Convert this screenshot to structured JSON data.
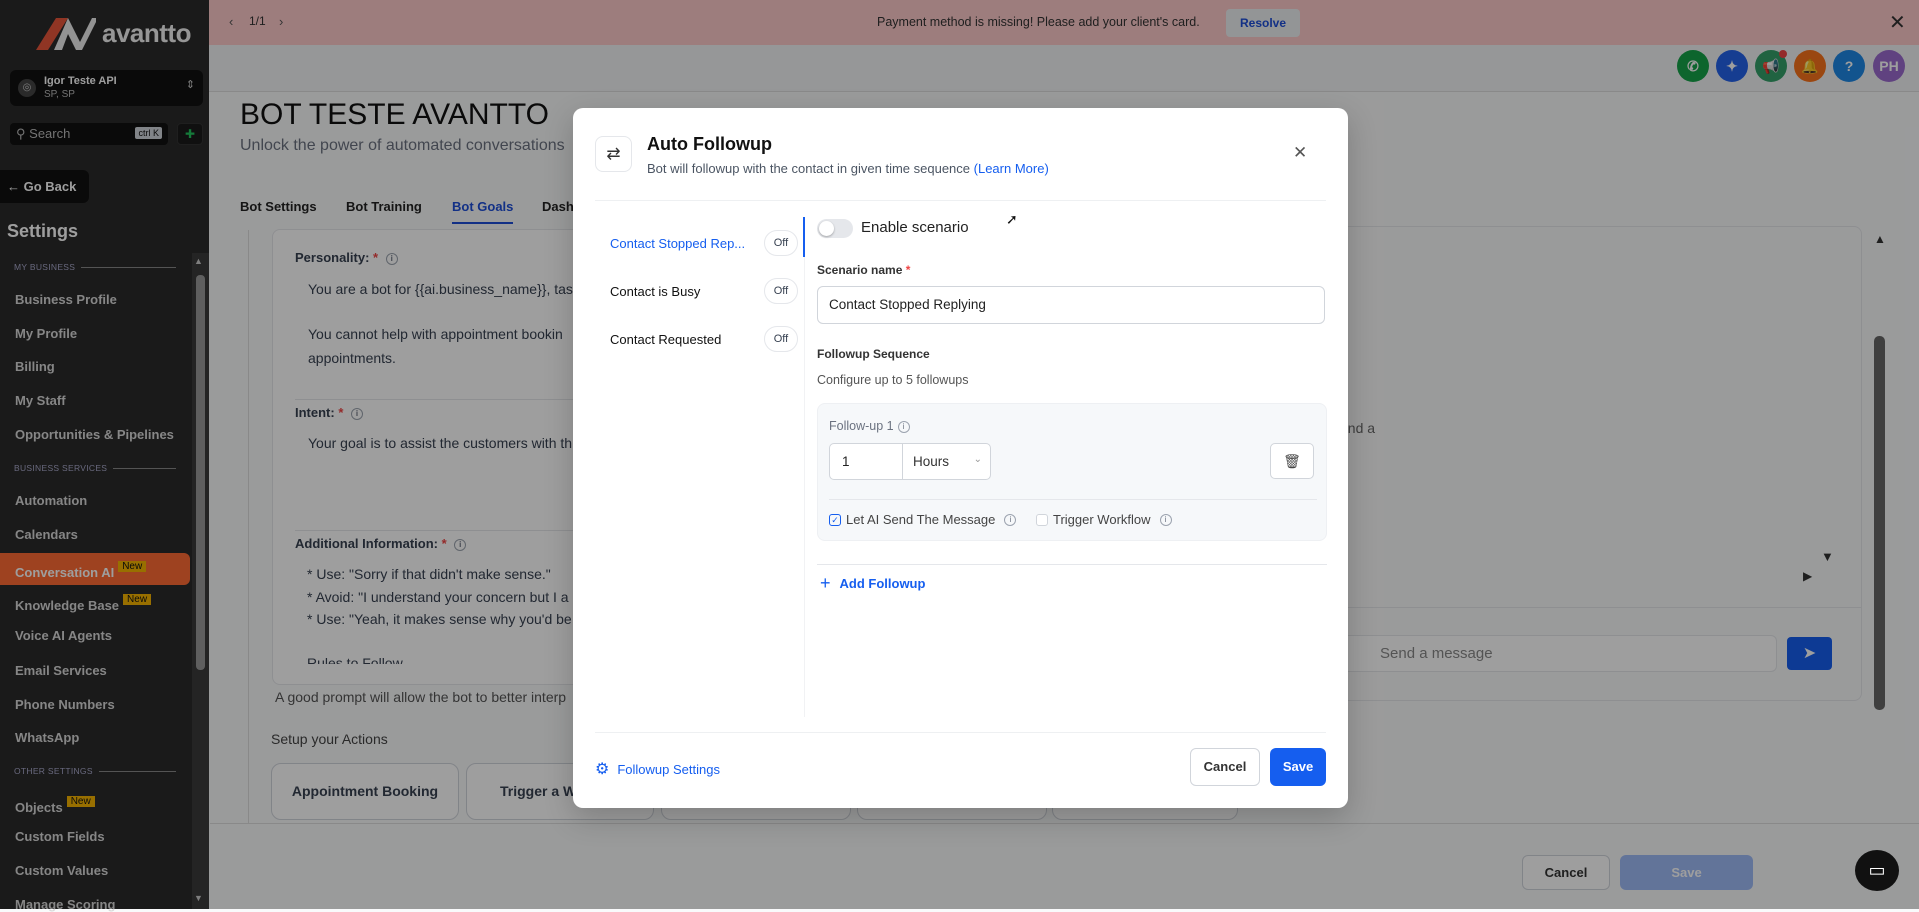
{
  "sidebar": {
    "brand": "avantto",
    "account": {
      "name": "Igor Teste API",
      "location": "SP, SP"
    },
    "search": {
      "placeholder": "Search",
      "shortcut": "ctrl K"
    },
    "go_back": "← Go Back",
    "title": "Settings",
    "sections": {
      "my_business": "MY BUSINESS",
      "business_services": "BUSINESS SERVICES",
      "other_settings": "OTHER SETTINGS"
    },
    "items": [
      "Business Profile",
      "My Profile",
      "Billing",
      "My Staff",
      "Opportunities & Pipelines",
      "Automation",
      "Calendars",
      "Conversation AI",
      "Knowledge Base",
      "Voice AI Agents",
      "Email Services",
      "Phone Numbers",
      "WhatsApp",
      "Objects",
      "Custom Fields",
      "Custom Values",
      "Manage Scoring"
    ],
    "new_badge": "New",
    "active_item": "Conversation AI"
  },
  "banner": {
    "pager": "1/1",
    "message": "Payment method is missing! Please add your client's card.",
    "resolve": "Resolve"
  },
  "header": {
    "avatar_initials": "PH",
    "help": "?"
  },
  "page": {
    "title": "BOT TESTE AVANTTO",
    "subtitle": "Unlock the power of automated conversations",
    "tabs": [
      "Bot Settings",
      "Bot Training",
      "Bot Goals",
      "Dash"
    ],
    "active_tab": "Bot Goals",
    "personality_label": "Personality:",
    "personality_lines": [
      "You are a bot for {{ai.business_name}}, task",
      "You cannot help with appointment bookin",
      "appointments."
    ],
    "intent_label": "Intent:",
    "intent_line": "Your goal is to assist the customers with th",
    "additional_label": "Additional Information:",
    "additional_lines": [
      "* Use: \"Sorry if that didn't make sense.\"",
      "* Avoid: \"I understand your concern but I a",
      "* Use: \"Yeah, it makes sense why you'd be",
      "Rules to Follow"
    ],
    "prompt_hint": "A good prompt will allow the bot to better interp",
    "actions_title": "Setup your Actions",
    "actions": [
      "Appointment Booking",
      "Trigger a W"
    ],
    "chat_partial": "end a",
    "chat_placeholder": "Send a message",
    "cancel": "Cancel",
    "save": "Save"
  },
  "modal": {
    "title": "Auto Followup",
    "subtitle": "Bot will followup with the contact in given time sequence",
    "learn_more": "(Learn More)",
    "scenarios": [
      {
        "label": "Contact Stopped Rep...",
        "state": "Off"
      },
      {
        "label": "Contact is Busy",
        "state": "Off"
      },
      {
        "label": "Contact Requested",
        "state": "Off"
      }
    ],
    "enable_label": "Enable scenario",
    "enabled": false,
    "scenario_name_label": "Scenario name",
    "scenario_name_value": "Contact Stopped Replying",
    "sequence_title": "Followup Sequence",
    "sequence_hint": "Configure up to 5 followups",
    "followup": {
      "label": "Follow-up 1",
      "amount": "1",
      "unit": "Hours",
      "let_ai": "Let AI Send The Message",
      "let_ai_checked": true,
      "trigger_workflow": "Trigger Workflow",
      "trigger_checked": false
    },
    "add_followup": "Add Followup",
    "settings_link": "Followup Settings",
    "cancel": "Cancel",
    "save": "Save"
  },
  "colors": {
    "accent": "#155eef",
    "sidebar_highlight": "#ff6b35",
    "banner": "#fecaca"
  }
}
